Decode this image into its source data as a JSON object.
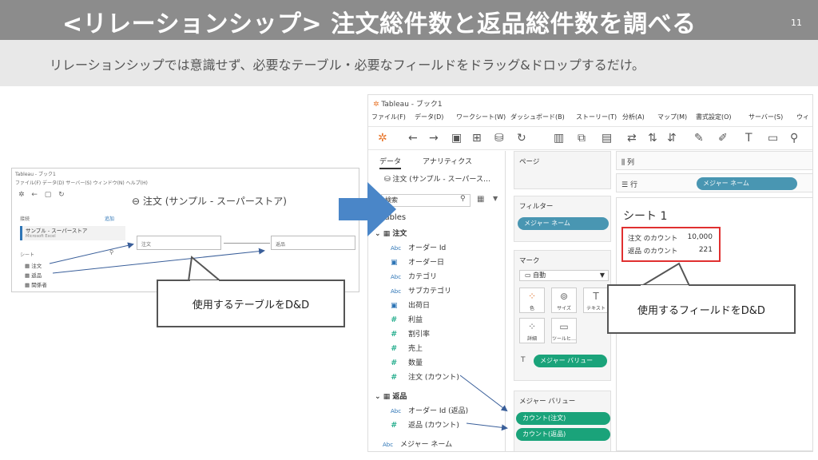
{
  "slide": {
    "title": "<リレーションシップ> 注文総件数と返品総件数を調べる",
    "page_number": "11",
    "subtitle": "リレーションシップでは意識せず、必要なテーブル・必要なフィールドをドラッグ&ドロップするだけ。"
  },
  "callouts": {
    "left": "使用するテーブルをD&D",
    "right": "使用するフィールドをD&D"
  },
  "small_screenshot": {
    "window_title": "Tableau - ブック1",
    "menu": "ファイル(F)  データ(D)  サーバー(S)  ウィンドウ(N)  ヘルプ(H)",
    "connection_label": "接続",
    "add_link": "追加",
    "datasource_name": "サンプル - スーパーストア",
    "datasource_type": "Microsoft Excel",
    "sheets_label": "シート",
    "sheets": [
      "注文",
      "返品",
      "関係者"
    ],
    "canvas_title": "注文 (サンプル - スーパーストア)",
    "table_left": "注文",
    "table_right": "返品"
  },
  "app": {
    "window_title": "Tableau - ブック1",
    "menu": [
      "ファイル(F)",
      "データ(D)",
      "ワークシート(W)",
      "ダッシュボード(B)",
      "ストーリー(T)",
      "分析(A)",
      "マップ(M)",
      "書式設定(O)",
      "サーバー(S)",
      "ウィ"
    ],
    "data_pane": {
      "tab_data": "データ",
      "tab_analytics": "アナリティクス",
      "datasource": "注文 (サンプル - スーパース…",
      "search_placeholder": "検索",
      "tables_label": "Tables",
      "orders_table": "注文",
      "orders_fields": [
        {
          "type": "Abc",
          "name": "オーダー Id"
        },
        {
          "type": "date",
          "name": "オーダー日"
        },
        {
          "type": "Abc",
          "name": "カテゴリ"
        },
        {
          "type": "Abc",
          "name": "サブカテゴリ"
        },
        {
          "type": "date",
          "name": "出荷日"
        },
        {
          "type": "#",
          "name": "利益"
        },
        {
          "type": "#",
          "name": "割引率"
        },
        {
          "type": "#",
          "name": "売上"
        },
        {
          "type": "#",
          "name": "数量"
        },
        {
          "type": "#",
          "name": "注文 (カウント)"
        }
      ],
      "returns_table": "返品",
      "returns_fields": [
        {
          "type": "Abc",
          "name": "オーダー Id (返品)"
        },
        {
          "type": "#",
          "name": "返品 (カウント)"
        }
      ],
      "measure_names": "メジャー ネーム"
    },
    "shelves": {
      "pages_title": "ページ",
      "filters_title": "フィルター",
      "filter_pill": "メジャー ネーム",
      "marks_title": "マーク",
      "marks_type": "自動",
      "mark_buttons": [
        "色",
        "サイズ",
        "テキスト",
        "詳細",
        "ツールヒ…"
      ],
      "marks_pill": "メジャー バリュー",
      "measure_values_title": "メジャー バリュー",
      "measure_values_pills": [
        "カウント(注文)",
        "カウント(返品)"
      ],
      "columns_label": "列",
      "rows_label": "行",
      "rows_pill": "メジャー ネーム"
    },
    "view": {
      "sheet_title": "シート 1",
      "rows": [
        {
          "label": "注文 のカウント",
          "value": "10,000"
        },
        {
          "label": "返品 のカウント",
          "value": "221"
        }
      ]
    }
  },
  "colors": {
    "title_bar": "#8c8c8c",
    "subtitle_bar": "#e8e8e8",
    "pill_blue": "#4996b2",
    "pill_green": "#1aa37a",
    "highlight_red": "#e03030",
    "arrow_blue": "#4a86c8"
  }
}
